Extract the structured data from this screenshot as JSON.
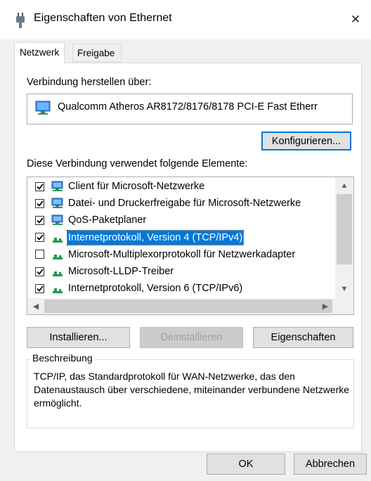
{
  "window": {
    "title": "Eigenschaften von Ethernet",
    "close_glyph": "✕"
  },
  "tabs": [
    {
      "label": "Netzwerk"
    },
    {
      "label": "Freigabe"
    }
  ],
  "connection": {
    "label": "Verbindung herstellen über:",
    "adapter": "Qualcomm Atheros AR8172/8176/8178 PCI-E Fast Etherr",
    "configure_button": "Konfigurieren..."
  },
  "elements": {
    "label": "Diese Verbindung verwendet folgende Elemente:",
    "items": [
      {
        "label": "Client für Microsoft-Netzwerke",
        "checked": true,
        "icon": "network-computer-icon",
        "selected": false
      },
      {
        "label": "Datei- und Druckerfreigabe für Microsoft-Netzwerke",
        "checked": true,
        "icon": "network-computer-icon",
        "selected": false
      },
      {
        "label": "QoS-Paketplaner",
        "checked": true,
        "icon": "network-computer-icon",
        "selected": false
      },
      {
        "label": "Internetprotokoll, Version 4 (TCP/IPv4)",
        "checked": true,
        "icon": "protocol-icon",
        "selected": true
      },
      {
        "label": "Microsoft-Multiplexorprotokoll für Netzwerkadapter",
        "checked": false,
        "icon": "protocol-icon",
        "selected": false
      },
      {
        "label": "Microsoft-LLDP-Treiber",
        "checked": true,
        "icon": "protocol-icon",
        "selected": false
      },
      {
        "label": "Internetprotokoll, Version 6 (TCP/IPv6)",
        "checked": true,
        "icon": "protocol-icon",
        "selected": false
      }
    ]
  },
  "buttons": {
    "install": "Installieren...",
    "uninstall": "Deinstallieren",
    "properties": "Eigenschaften",
    "ok": "OK",
    "cancel": "Abbrechen"
  },
  "description": {
    "legend": "Beschreibung",
    "text": "TCP/IP, das Standardprotokoll für WAN-Netzwerke, das den Datenaustausch über verschiedene, miteinander verbundene Netzwerke ermöglicht."
  },
  "colors": {
    "accent": "#0078d7",
    "window_bg": "#f0f0f0"
  }
}
